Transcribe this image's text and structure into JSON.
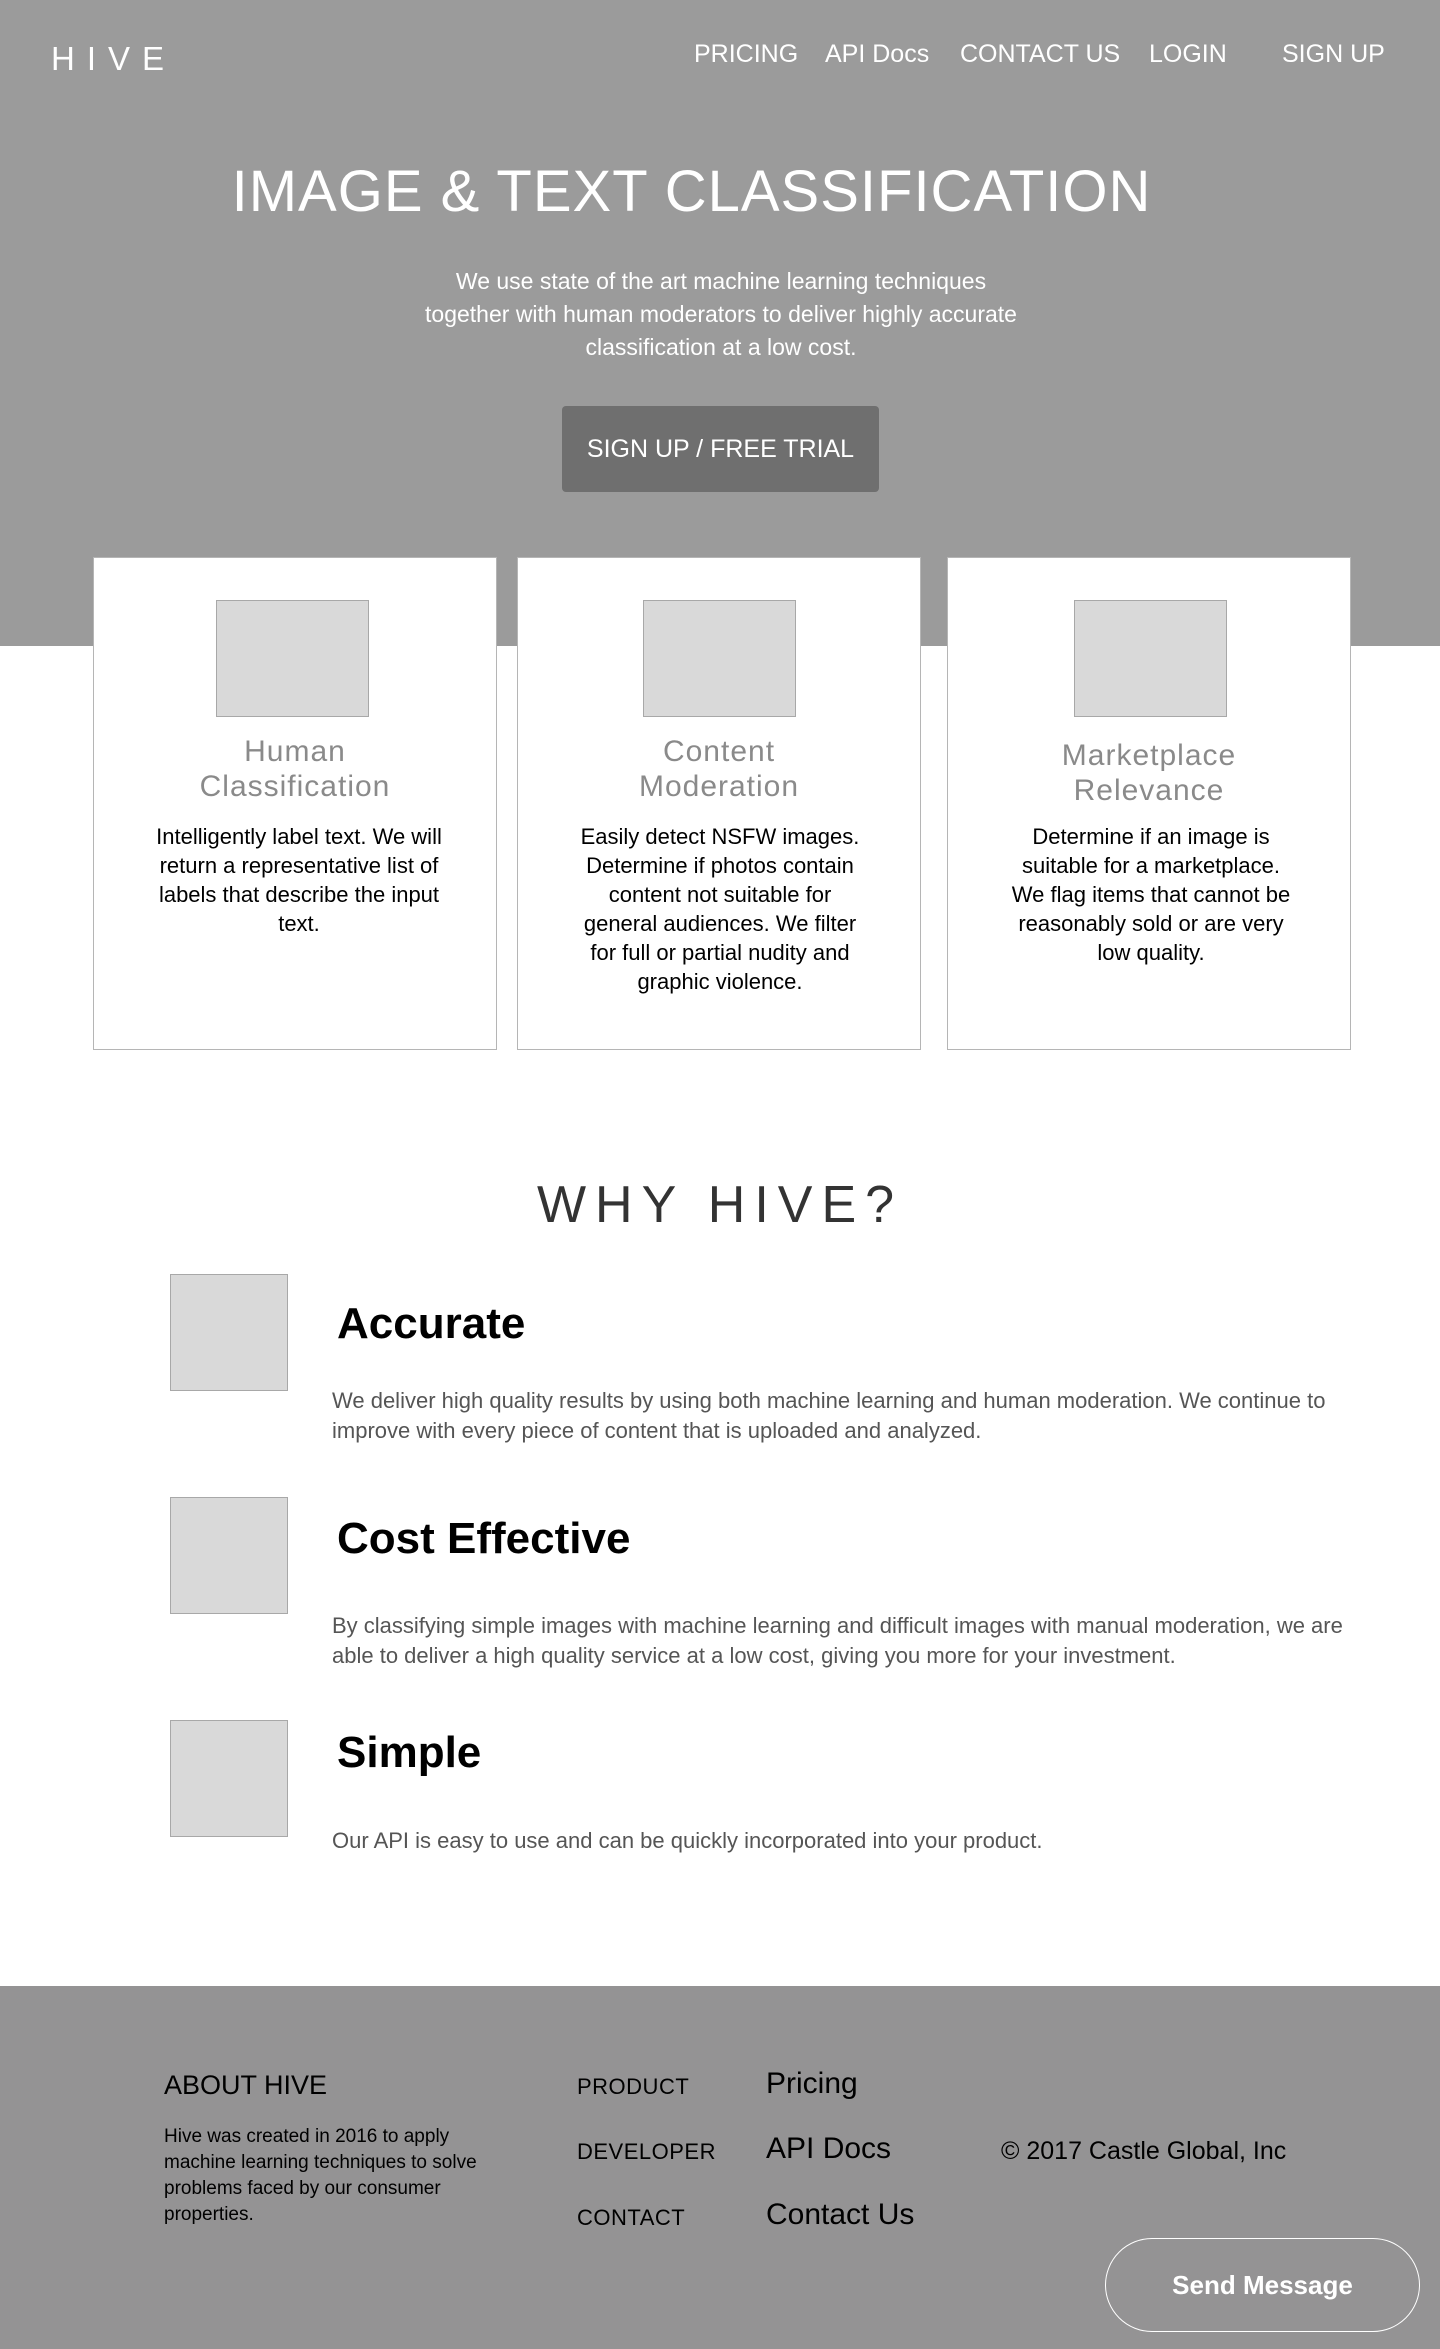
{
  "header": {
    "logo": "HIVE",
    "nav": [
      "PRICING",
      "API Docs",
      "CONTACT US",
      "LOGIN",
      "SIGN UP"
    ]
  },
  "hero": {
    "title": "IMAGE & TEXT CLASSIFICATION",
    "subtitle": "We use state of the art machine learning techniques together with human moderators to deliver highly accurate classification at a low cost.",
    "cta_label": "SIGN UP / FREE TRIAL"
  },
  "cards": [
    {
      "title_line1": "Human",
      "title_line2": "Classification",
      "text": "Intelligently label text. We will return a representative list of labels that describe the input text."
    },
    {
      "title_line1": "Content",
      "title_line2": "Moderation",
      "text": "Easily detect NSFW images. Determine if photos contain content not suitable for general audiences. We filter for full or partial nudity and graphic violence."
    },
    {
      "title_line1": "Marketplace",
      "title_line2": "Relevance",
      "text": "Determine if an image is suitable for a marketplace. We flag items that cannot be reasonably sold or are very low quality."
    }
  ],
  "why": {
    "title": "WHY HIVE?",
    "features": [
      {
        "title": "Accurate",
        "text": "We deliver high quality results by using both machine learning and human moderation. We continue to improve with every piece of content that is uploaded and analyzed."
      },
      {
        "title": "Cost Effective",
        "text": "By classifying simple images with machine learning and difficult images with manual moderation, we are able to deliver a high quality service at a low cost, giving you more for your investment."
      },
      {
        "title": "Simple",
        "text": "Our API is easy to use and can be quickly incorporated into your product."
      }
    ]
  },
  "footer": {
    "about_heading": "ABOUT HIVE",
    "about_text": "Hive was created in 2016 to apply machine learning techniques to solve problems faced by our consumer properties.",
    "labels": [
      "PRODUCT",
      "DEVELOPER",
      "CONTACT"
    ],
    "links": [
      "Pricing",
      "API Docs",
      "Contact Us"
    ],
    "copyright": "© 2017 Castle Global, Inc",
    "send_label": "Send Message"
  },
  "colors": {
    "hero_bg": "#9b9b9b",
    "cta_bg": "#6f6f6f",
    "footer_bg": "#949394",
    "placeholder": "#d9d9d9"
  }
}
